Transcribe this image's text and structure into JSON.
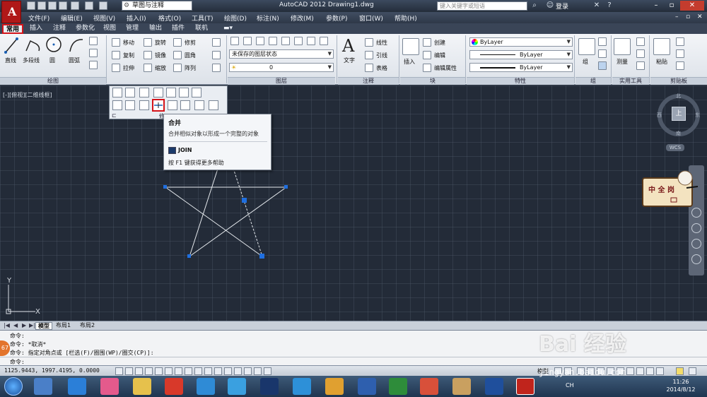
{
  "title": "AutoCAD 2012    Drawing1.dwg",
  "workspace": "草图与注释",
  "search_placeholder": "键入关键字或短语",
  "login": "登录",
  "menu": [
    "文件(F)",
    "编辑(E)",
    "视图(V)",
    "插入(I)",
    "格式(O)",
    "工具(T)",
    "绘图(D)",
    "标注(N)",
    "修改(M)",
    "参数(P)",
    "窗口(W)",
    "帮助(H)"
  ],
  "ribbon_tabs": [
    "常用",
    "插入",
    "注释",
    "参数化",
    "视图",
    "管理",
    "输出",
    "插件",
    "联机"
  ],
  "ribbon": {
    "draw": {
      "title": "绘图",
      "line": "直线",
      "polyline": "多段线",
      "circle": "圆",
      "arc": "圆弧"
    },
    "modify": {
      "move": "移动",
      "rotate": "旋转",
      "trim": "修剪",
      "copy": "复制",
      "mirror": "镜像",
      "fillet": "圆角",
      "stretch": "拉伸",
      "scale": "缩放",
      "array": "阵列"
    },
    "layers": {
      "title": "图层",
      "state": "未保存的图层状态",
      "current": "0"
    },
    "annotation": {
      "title": "注释",
      "text": "文字",
      "linear": "线性",
      "leader": "引线",
      "table": "表格"
    },
    "block": {
      "title": "块",
      "insert": "插入",
      "create": "创建",
      "edit": "编辑",
      "edit_attr": "编辑属性"
    },
    "properties": {
      "title": "特性",
      "color": "ByLayer",
      "linetype": "ByLayer",
      "lineweight": "ByLayer"
    },
    "groups": {
      "title": "组",
      "group": "组"
    },
    "utilities": {
      "title": "实用工具",
      "measure": "测量"
    },
    "clipboard": {
      "title": "剪贴板",
      "paste": "粘贴"
    }
  },
  "viewport_label": "[-][俯视][二维线框]",
  "flyout_title": "修",
  "tooltip": {
    "title": "合并",
    "desc": "合并相似对象以形成一个完整的对象",
    "command": "JOIN",
    "help": "按 F1 键获得更多帮助"
  },
  "compass": {
    "north": "北",
    "south": "南",
    "east": "东",
    "west": "西",
    "top": "上"
  },
  "wcs": "WCS",
  "stamp_text": "中 全 岗",
  "ucs": {
    "y": "Y",
    "x": "X"
  },
  "layout_tabs": [
    "模型",
    "布局1",
    "布局2"
  ],
  "command_lines": [
    "命令:",
    "命令: *取消*",
    "命令: 指定对角点或 [栏选(F)/圈围(WP)/圈交(CP)]:",
    "命令:"
  ],
  "coordinates": "1125.9443,  1997.4195,  0.0000",
  "status_model": "模型",
  "clock": {
    "time": "11:26",
    "date": "2014/8/12"
  },
  "lang": "CH",
  "badge": "67",
  "watermark": "Bai 经验",
  "watermark_url": "jingyan.baidu.com"
}
